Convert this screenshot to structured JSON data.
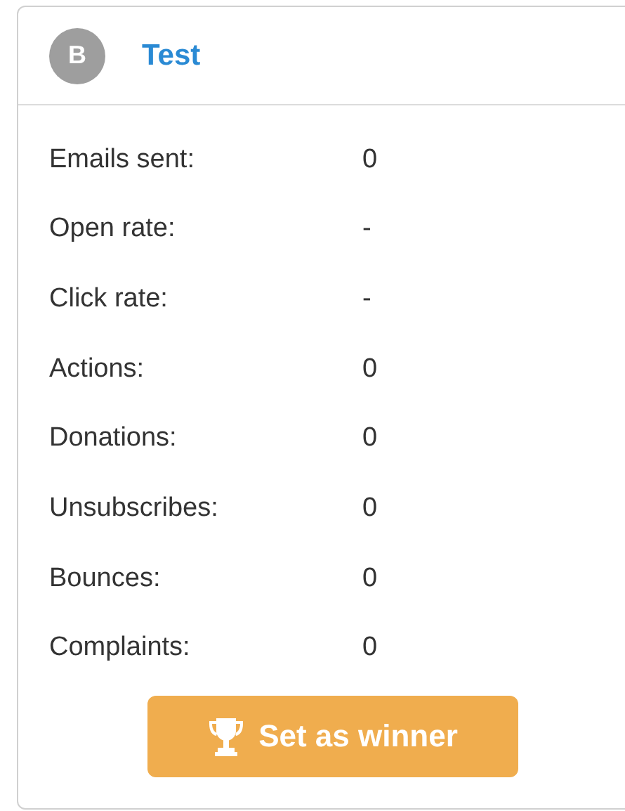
{
  "header": {
    "avatar": "B",
    "title": "Test"
  },
  "stats": [
    {
      "label": "Emails sent:",
      "value": "0"
    },
    {
      "label": "Open rate:",
      "value": "-"
    },
    {
      "label": "Click rate:",
      "value": "-"
    },
    {
      "label": "Actions:",
      "value": "0"
    },
    {
      "label": "Donations:",
      "value": "0"
    },
    {
      "label": "Unsubscribes:",
      "value": "0"
    },
    {
      "label": "Bounces:",
      "value": "0"
    },
    {
      "label": "Complaints:",
      "value": "0"
    }
  ],
  "button": {
    "label": "Set as winner"
  }
}
